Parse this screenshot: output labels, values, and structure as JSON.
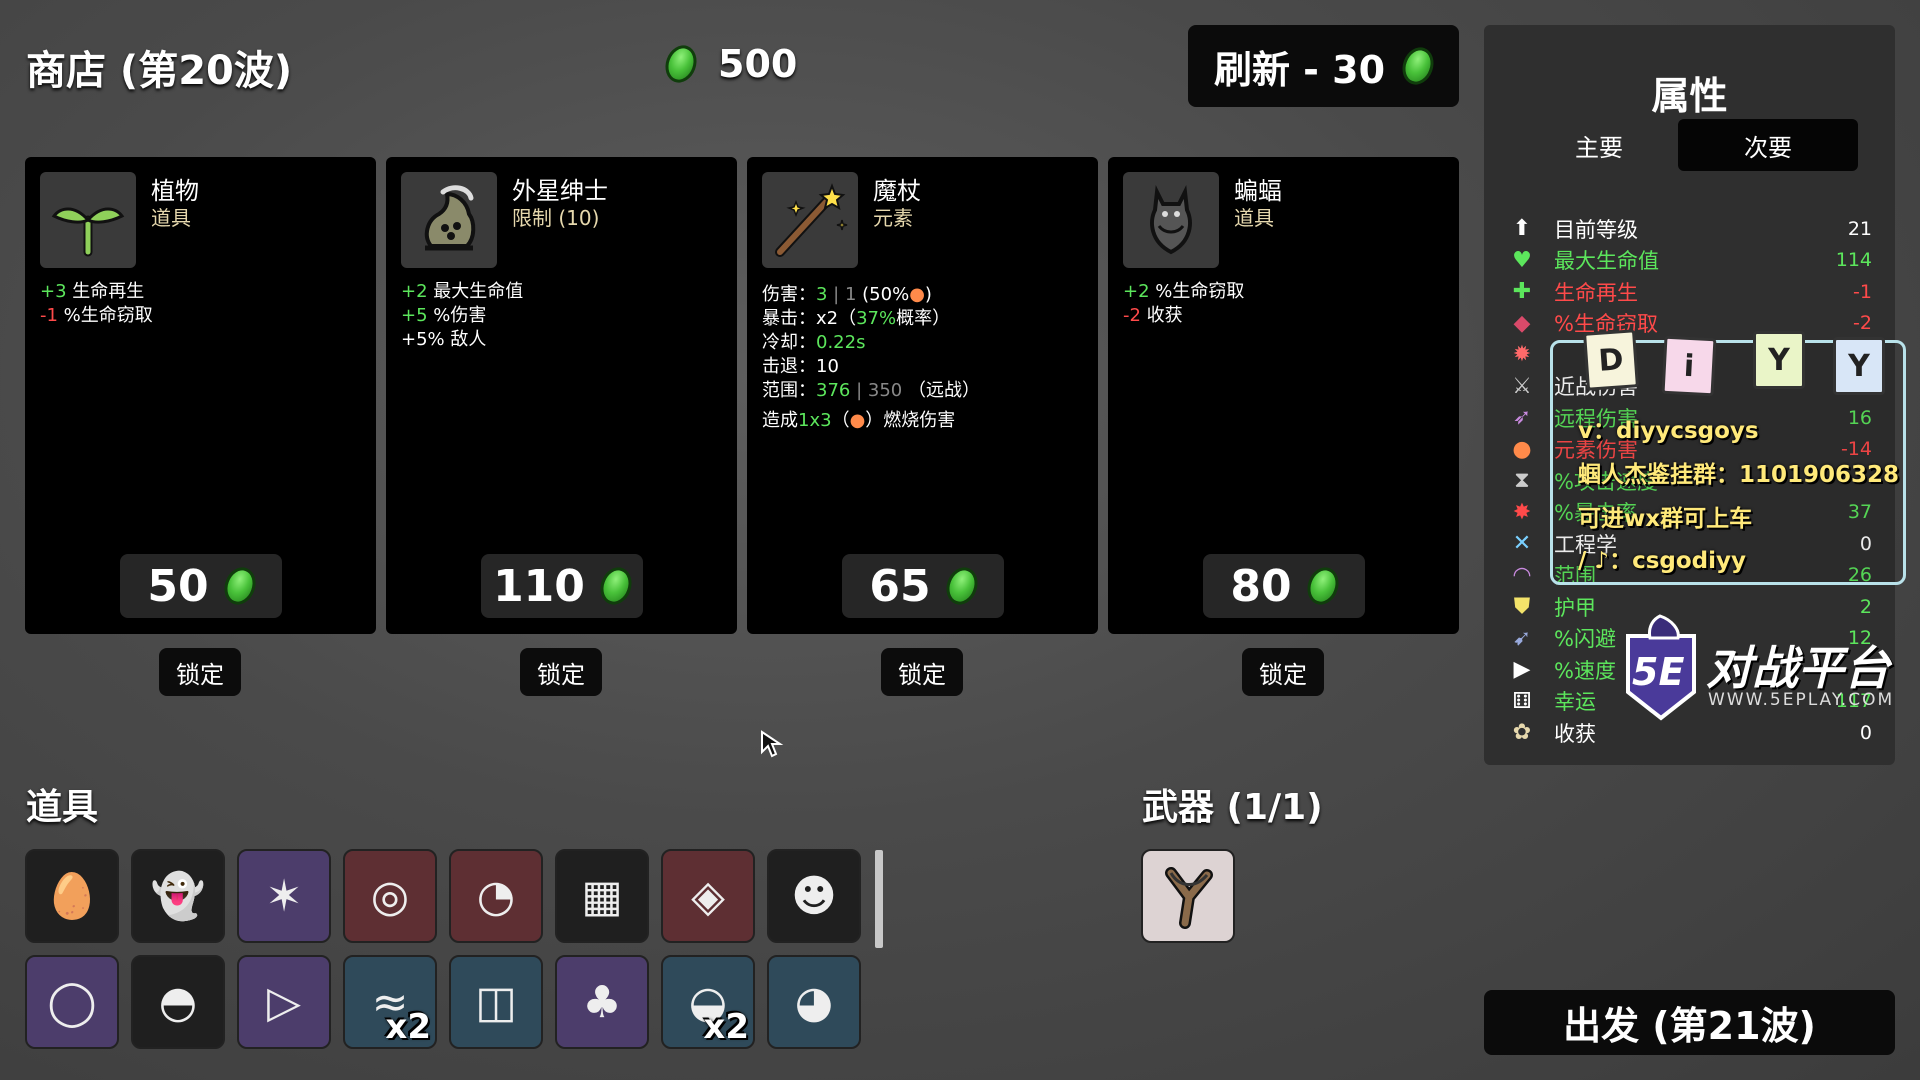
{
  "shop": {
    "title": "商店 (第20波)",
    "currency": "500",
    "refresh_label": "刷新 - 30"
  },
  "cards": [
    {
      "name": "植物",
      "type": "道具",
      "icon": "sprout-icon",
      "price": "50",
      "lock_label": "锁定",
      "stats": [
        {
          "val": "+3",
          "val_class": "g",
          "text": " 生命再生"
        },
        {
          "val": "-1",
          "val_class": "r",
          "text": " %生命窃取"
        }
      ]
    },
    {
      "name": "外星绅士",
      "type": "限制 (10)",
      "icon": "alien-gentleman-icon",
      "price": "110",
      "lock_label": "锁定",
      "stats": [
        {
          "val": "+2",
          "val_class": "g",
          "text": " 最大生命值"
        },
        {
          "val": "+5",
          "val_class": "g",
          "text": " %伤害"
        },
        {
          "val": "",
          "val_class": "",
          "text": "+5% 敌人"
        }
      ]
    },
    {
      "name": "魔杖",
      "type": "元素",
      "icon": "magic-wand-icon",
      "price": "65",
      "lock_label": "锁定",
      "weapon_stats": {
        "damage_label": "伤害：",
        "damage_value": "3",
        "damage_base": "1",
        "damage_scaling": "(50%",
        "crit_label": "暴击：",
        "crit_mult": "x2（",
        "crit_chance": "37%",
        "crit_suffix": "概率）",
        "cooldown_label": "冷却：",
        "cooldown_value": "0.22s",
        "knockback_label": "击退：",
        "knockback_value": "10",
        "range_label": "范围：",
        "range_value": "376",
        "range_base": "350",
        "range_type": "（远战）",
        "effect_prefix": "造成",
        "effect_value": "1x3",
        "effect_suffix": "）燃烧伤害"
      }
    },
    {
      "name": "蝙蝠",
      "type": "道具",
      "icon": "bat-icon",
      "price": "80",
      "lock_label": "锁定",
      "stats": [
        {
          "val": "+2",
          "val_class": "g",
          "text": " %生命窃取"
        },
        {
          "val": "-2",
          "val_class": "r",
          "text": " 收获"
        }
      ]
    }
  ],
  "items_section": {
    "title": "道具",
    "items": [
      {
        "icon": "egg-face-icon",
        "color": "dark",
        "count": ""
      },
      {
        "icon": "ghost-robe-icon",
        "color": "dark",
        "count": ""
      },
      {
        "icon": "scarecrow-icon",
        "color": "purple",
        "count": ""
      },
      {
        "icon": "binoculars-icon",
        "color": "red",
        "count": ""
      },
      {
        "icon": "stomach-icon",
        "color": "red",
        "count": ""
      },
      {
        "icon": "plaid-shirt-icon",
        "color": "dark",
        "count": ""
      },
      {
        "icon": "red-hoodie-icon",
        "color": "red",
        "count": ""
      },
      {
        "icon": "skull-mask-icon",
        "color": "dark",
        "count": ""
      },
      {
        "icon": "ring-icon",
        "color": "purple",
        "count": ""
      },
      {
        "icon": "propeller-hat-icon",
        "color": "dark",
        "count": ""
      },
      {
        "icon": "triangle-icon",
        "color": "purple",
        "count": ""
      },
      {
        "icon": "scarf-icon",
        "color": "blue",
        "count": "x2"
      },
      {
        "icon": "glasses-icon",
        "color": "blue",
        "count": ""
      },
      {
        "icon": "clover-icon",
        "color": "purple",
        "count": ""
      },
      {
        "icon": "helmet-icon",
        "color": "blue",
        "count": "x2"
      },
      {
        "icon": "piggy-bank-icon",
        "color": "blue",
        "count": ""
      }
    ]
  },
  "weapons_section": {
    "title": "武器 (1/1)",
    "weapon_icon": "slingshot-icon"
  },
  "attributes": {
    "title": "属性",
    "tab_primary": "主要",
    "tab_secondary": "次要",
    "rows": [
      {
        "icon": "level-icon",
        "name": "目前等级",
        "value": "21",
        "color": "#ffffff",
        "icon_color": "#ffffff"
      },
      {
        "icon": "heart-icon",
        "name": "最大生命值",
        "value": "114",
        "color": "#5ce65c",
        "icon_color": "#5ce65c"
      },
      {
        "icon": "regen-icon",
        "name": "生命再生",
        "value": "-1",
        "color": "#ff4a4a",
        "icon_color": "#5ce65c"
      },
      {
        "icon": "lifesteal-icon",
        "name": "%生命窃取",
        "value": "-2",
        "color": "#ff4a4a",
        "icon_color": "#d94a6a"
      },
      {
        "icon": "damage-icon",
        "name": "",
        "value": "",
        "color": "#ffffff",
        "icon_color": "#ff6a6a"
      },
      {
        "icon": "melee-icon",
        "name": "近战伤害",
        "value": "",
        "color": "#ffffff",
        "icon_color": "#ccc"
      },
      {
        "icon": "ranged-icon",
        "name": "远程伤害",
        "value": "16",
        "color": "#5ce65c",
        "icon_color": "#c98adf"
      },
      {
        "icon": "elemental-icon",
        "name": "元素伤害",
        "value": "-14",
        "color": "#ff4a4a",
        "icon_color": "#ff8a4a"
      },
      {
        "icon": "attack-speed-icon",
        "name": "%攻击速度",
        "value": "",
        "color": "#5ce65c",
        "icon_color": "#ccc"
      },
      {
        "icon": "crit-icon",
        "name": "%暴击率",
        "value": "37",
        "color": "#5ce65c",
        "icon_color": "#ff4a4a"
      },
      {
        "icon": "engineering-icon",
        "name": "工程学",
        "value": "0",
        "color": "#ffffff",
        "icon_color": "#7ad0ff"
      },
      {
        "icon": "range-icon",
        "name": "范围",
        "value": "26",
        "color": "#5ce65c",
        "icon_color": "#c98adf"
      },
      {
        "icon": "armor-icon",
        "name": "护甲",
        "value": "2",
        "color": "#5ce65c",
        "icon_color": "#f3e36a"
      },
      {
        "icon": "dodge-icon",
        "name": "%闪避",
        "value": "12",
        "color": "#5ce65c",
        "icon_color": "#9ad"
      },
      {
        "icon": "speed-icon",
        "name": "%速度",
        "value": "",
        "color": "#5ce65c",
        "icon_color": "#fff"
      },
      {
        "icon": "luck-icon",
        "name": "幸运",
        "value": "117",
        "color": "#5ce65c",
        "icon_color": "#fff"
      },
      {
        "icon": "harvest-icon",
        "name": "收获",
        "value": "0",
        "color": "#ffffff",
        "icon_color": "#e6d8ad"
      }
    ]
  },
  "go_button": "出发 (第21波)",
  "overlay": {
    "tags": [
      "D",
      "i",
      "Y",
      "Y"
    ],
    "line1": "v：diyycsgoys",
    "line2": "蝈人杰鉴挂群：1101906328",
    "line3": "可进wx群可上车",
    "line4": "/ ♪：csgodiyy",
    "brand_short": "5E",
    "brand_name": "对战平台",
    "brand_url": "WWW.5EPLAY.COM"
  }
}
